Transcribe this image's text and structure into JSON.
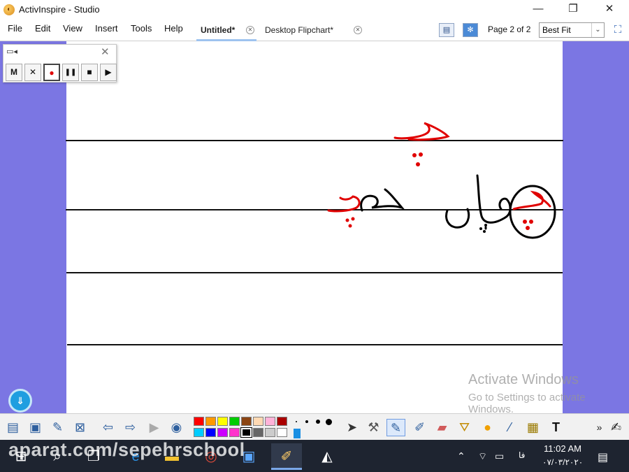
{
  "window": {
    "title": "ActivInspire - Studio",
    "minimize": "—",
    "restore": "❐",
    "close": "✕"
  },
  "menu": [
    {
      "label": "File"
    },
    {
      "label": "Edit"
    },
    {
      "label": "View"
    },
    {
      "label": "Insert"
    },
    {
      "label": "Tools"
    },
    {
      "label": "Help"
    }
  ],
  "tabs": [
    {
      "label": "Untitled*",
      "active": true
    },
    {
      "label": "Desktop Flipchart*",
      "active": false
    }
  ],
  "page_indicator": "Page 2 of 2",
  "zoom": {
    "value": "Best Fit"
  },
  "recorder": {
    "buttons": [
      "M",
      "✕",
      "●",
      "❚❚",
      "■",
      "▶"
    ]
  },
  "handwriting": {
    "red_word_top": "ج",
    "red_dots": "••",
    "black_word_dooj": "دو",
    "red_word_dooj": "ج",
    "black_word_chopan": "وپان",
    "red_word_chopan": "ج"
  },
  "watermark": {
    "title": "Activate Windows",
    "subtitle": "Go to Settings to activate",
    "subtitle2": "Windows."
  },
  "palette": {
    "row1": [
      "#ff0000",
      "#ff9900",
      "#ffff00",
      "#00cc00",
      "#8b4513",
      "#ffd9b3",
      "#ffb3d9",
      "#aa0000"
    ],
    "row2": [
      "#00ccff",
      "#0000ff",
      "#cc00ff",
      "#ff33cc",
      "#000000",
      "#666666",
      "#cccccc",
      "#ffffff"
    ]
  },
  "pen_colors": {
    "red": "#e00000",
    "black": "#000000"
  },
  "taskbar": {
    "watermark": "aparat.com/sepehrschool",
    "time": "11:02 AM",
    "date": "۰۷/۰۳/۲۰۲۰",
    "lang": "فا"
  }
}
